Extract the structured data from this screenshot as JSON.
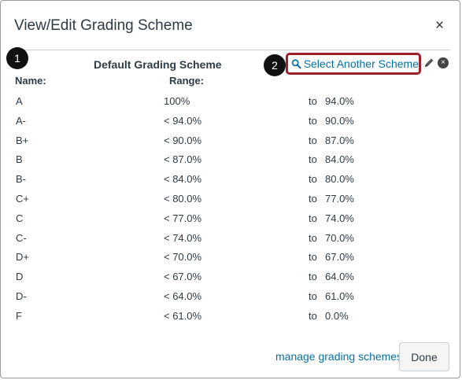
{
  "dialog": {
    "title": "View/Edit Grading Scheme",
    "close_symbol": "×"
  },
  "callouts": {
    "one": "1",
    "two": "2"
  },
  "scheme": {
    "title": "Default Grading Scheme",
    "select_link": "Select Another Scheme",
    "select_icon": "search-icon",
    "edit_icon": "pencil-icon",
    "remove_icon": "remove-icon",
    "remove_symbol": "×"
  },
  "table": {
    "headers": {
      "name": "Name:",
      "range": "Range:"
    },
    "rows": [
      {
        "name": "A",
        "upper": "100%",
        "to": "to",
        "lower": "94.0%"
      },
      {
        "name": "A-",
        "upper": "< 94.0%",
        "to": "to",
        "lower": "90.0%"
      },
      {
        "name": "B+",
        "upper": "< 90.0%",
        "to": "to",
        "lower": "87.0%"
      },
      {
        "name": "B",
        "upper": "< 87.0%",
        "to": "to",
        "lower": "84.0%"
      },
      {
        "name": "B-",
        "upper": "< 84.0%",
        "to": "to",
        "lower": "80.0%"
      },
      {
        "name": "C+",
        "upper": "< 80.0%",
        "to": "to",
        "lower": "77.0%"
      },
      {
        "name": "C",
        "upper": "< 77.0%",
        "to": "to",
        "lower": "74.0%"
      },
      {
        "name": "C-",
        "upper": "< 74.0%",
        "to": "to",
        "lower": "70.0%"
      },
      {
        "name": "D+",
        "upper": "< 70.0%",
        "to": "to",
        "lower": "67.0%"
      },
      {
        "name": "D",
        "upper": "< 67.0%",
        "to": "to",
        "lower": "64.0%"
      },
      {
        "name": "D-",
        "upper": "< 64.0%",
        "to": "to",
        "lower": "61.0%"
      },
      {
        "name": "F",
        "upper": "< 61.0%",
        "to": "to",
        "lower": "0.0%"
      }
    ]
  },
  "footer": {
    "manage_link": "manage grading schemes",
    "done_label": "Done"
  },
  "colors": {
    "link": "#0770a3",
    "highlight_border": "#a0202a",
    "text": "#2d3b45"
  }
}
